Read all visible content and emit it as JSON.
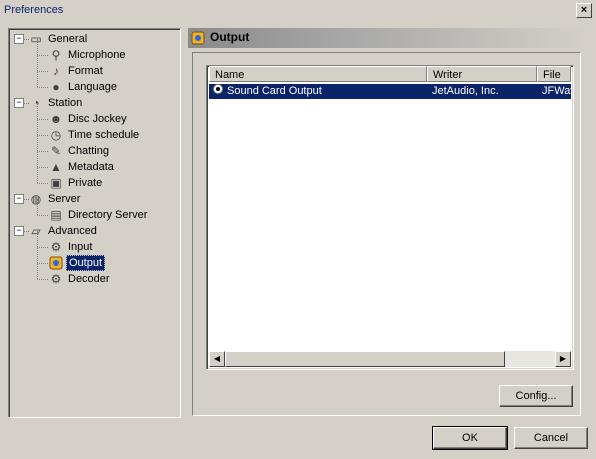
{
  "window": {
    "title": "Preferences",
    "close_label": "×"
  },
  "tree": {
    "items": [
      {
        "label": "General",
        "icon": "general-icon",
        "level": 0,
        "expander": "−"
      },
      {
        "label": "Microphone",
        "icon": "microphone-icon",
        "level": 1
      },
      {
        "label": "Format",
        "icon": "format-icon",
        "level": 1
      },
      {
        "label": "Language",
        "icon": "language-icon",
        "level": 1
      },
      {
        "label": "Station",
        "icon": "station-icon",
        "level": 0,
        "expander": "−"
      },
      {
        "label": "Disc Jockey",
        "icon": "disc-jockey-icon",
        "level": 1
      },
      {
        "label": "Time schedule",
        "icon": "clock-icon",
        "level": 1
      },
      {
        "label": "Chatting",
        "icon": "chat-icon",
        "level": 1
      },
      {
        "label": "Metadata",
        "icon": "metadata-icon",
        "level": 1
      },
      {
        "label": "Private",
        "icon": "private-icon",
        "level": 1
      },
      {
        "label": "Server",
        "icon": "server-icon",
        "level": 0,
        "expander": "−"
      },
      {
        "label": "Directory Server",
        "icon": "directory-server-icon",
        "level": 1
      },
      {
        "label": "Advanced",
        "icon": "advanced-icon",
        "level": 0,
        "expander": "−"
      },
      {
        "label": "Input",
        "icon": "input-icon",
        "level": 1
      },
      {
        "label": "Output",
        "icon": "output-icon",
        "level": 1,
        "selected": true
      },
      {
        "label": "Decoder",
        "icon": "decoder-icon",
        "level": 1
      }
    ]
  },
  "panel": {
    "title": "Output",
    "icon": "output-icon",
    "list": {
      "columns": [
        "Name",
        "Writer",
        "File"
      ],
      "rows": [
        {
          "name": "Sound Card Output",
          "writer": "JetAudio, Inc.",
          "file": "JFWav",
          "selected": true
        }
      ]
    },
    "config_label": "Config..."
  },
  "buttons": {
    "ok": "OK",
    "cancel": "Cancel"
  },
  "colors": {
    "selection": "#0a246a",
    "face": "#d4d0c8",
    "title_text": "#0a246a"
  }
}
